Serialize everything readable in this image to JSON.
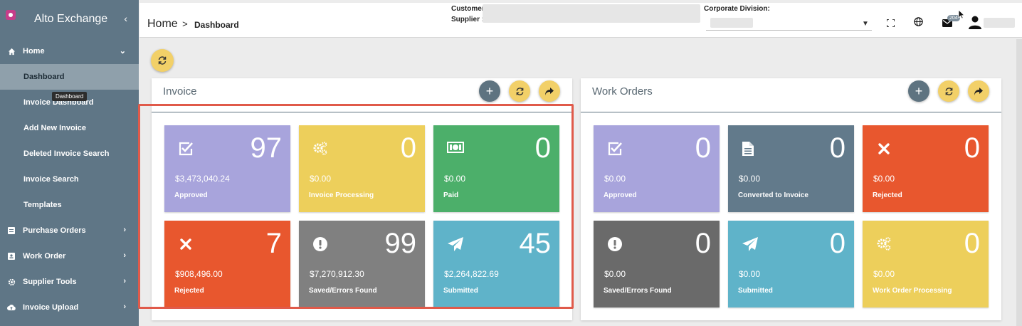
{
  "colors": {
    "sidebar": "#5f7686",
    "approved": "#a8a4dc",
    "processing": "#edcf5b",
    "paid": "#4caf6a",
    "rejected": "#e8572e",
    "errors": "#808080",
    "submitted": "#5fb3c9",
    "converted": "#627a8b",
    "errors_wo": "#6a6a6a"
  },
  "sidebar": {
    "brand": "Alto Exchange",
    "tooltip": "Dashboard",
    "items": [
      {
        "label": "Home",
        "icon": "home-icon"
      },
      {
        "label": "Dashboard"
      },
      {
        "label": "Invoice Dashboard"
      },
      {
        "label": "Add New Invoice"
      },
      {
        "label": "Deleted Invoice Search"
      },
      {
        "label": "Invoice Search"
      },
      {
        "label": "Templates"
      },
      {
        "label": "Purchase Orders",
        "icon": "document-icon"
      },
      {
        "label": "Work Order",
        "icon": "badge-icon"
      },
      {
        "label": "Supplier Tools",
        "icon": "gear-icon"
      },
      {
        "label": "Invoice Upload",
        "icon": "cloud-upload-icon"
      }
    ]
  },
  "header": {
    "breadcrumb_home": "Home",
    "breadcrumb_sep": ">",
    "breadcrumb_current": "Dashboard",
    "customer_label": "Customer",
    "supplier_label": "Supplier :",
    "corporate_division_label": "Corporate Division:",
    "notification_count": "204"
  },
  "invoice": {
    "title": "Invoice",
    "tiles": [
      {
        "count": "97",
        "amount": "$3,473,040.24",
        "label": "Approved",
        "icon": "checkbox-icon",
        "color": "#a8a4dc"
      },
      {
        "count": "0",
        "amount": "$0.00",
        "label": "Invoice Processing",
        "icon": "gears-icon",
        "color": "#edcf5b"
      },
      {
        "count": "0",
        "amount": "$0.00",
        "label": "Paid",
        "icon": "cash-icon",
        "color": "#4caf6a"
      },
      {
        "count": "7",
        "amount": "$908,496.00",
        "label": "Rejected",
        "icon": "x-icon",
        "color": "#e8572e"
      },
      {
        "count": "99",
        "amount": "$7,270,912.30",
        "label": "Saved/Errors Found",
        "icon": "exclamation-icon",
        "color": "#808080"
      },
      {
        "count": "45",
        "amount": "$2,264,822.69",
        "label": "Submitted",
        "icon": "paper-plane-icon",
        "color": "#5fb3c9"
      }
    ]
  },
  "work_orders": {
    "title": "Work Orders",
    "tiles": [
      {
        "count": "0",
        "amount": "$0.00",
        "label": "Approved",
        "icon": "checkbox-icon",
        "color": "#a8a4dc"
      },
      {
        "count": "0",
        "amount": "$0.00",
        "label": "Converted to Invoice",
        "icon": "file-icon",
        "color": "#627a8b"
      },
      {
        "count": "0",
        "amount": "$0.00",
        "label": "Rejected",
        "icon": "x-icon",
        "color": "#e8572e"
      },
      {
        "count": "0",
        "amount": "$0.00",
        "label": "Saved/Errors Found",
        "icon": "exclamation-icon",
        "color": "#6a6a6a"
      },
      {
        "count": "0",
        "amount": "$0.00",
        "label": "Submitted",
        "icon": "paper-plane-icon",
        "color": "#5fb3c9"
      },
      {
        "count": "0",
        "amount": "$0.00",
        "label": "Work Order Processing",
        "icon": "gears-icon",
        "color": "#edcf5b"
      }
    ]
  }
}
